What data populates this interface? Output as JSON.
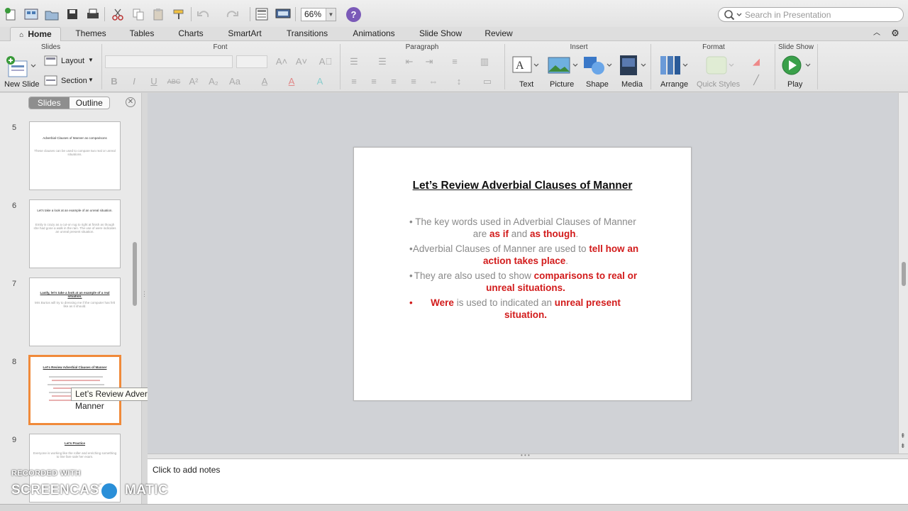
{
  "toolbar": {
    "zoom": "66%",
    "help": "?",
    "search_placeholder": "Search in Presentation",
    "icons": [
      "new-icon",
      "templates-icon",
      "open-icon",
      "save-icon",
      "print-icon",
      "cut-icon",
      "copy-icon",
      "paste-icon",
      "format-painter-icon",
      "undo-icon",
      "redo-icon",
      "slide-sorter-icon",
      "present-icon",
      "help-icon"
    ]
  },
  "tabs": [
    "Home",
    "Themes",
    "Tables",
    "Charts",
    "SmartArt",
    "Transitions",
    "Animations",
    "Slide Show",
    "Review"
  ],
  "ribbon": {
    "groups": {
      "slides": "Slides",
      "font": "Font",
      "paragraph": "Paragraph",
      "insert": "Insert",
      "format": "Format",
      "slideshow": "Slide Show"
    },
    "new_slide": "New Slide",
    "layout": "Layout",
    "section": "Section",
    "text": "Text",
    "picture": "Picture",
    "shape": "Shape",
    "media": "Media",
    "arrange": "Arrange",
    "quick_styles": "Quick Styles",
    "play": "Play"
  },
  "panel": {
    "seg_slides": "Slides",
    "seg_outline": "Outline",
    "slides": [
      {
        "num": "5",
        "title": "Adverbial Clauses of Manner as comparisons",
        "body": "These clauses can be used to compare two real or unreal situations."
      },
      {
        "num": "6",
        "title": "Let's take a look at an example of an unreal situation.",
        "body": "Emily is crazy as a cut-on rug to right at finish as though she had gone a walk in the rain. The use of were indicates an unreal present situation."
      },
      {
        "num": "7",
        "title": "Lastly, let's take a look at an example of a real situation.",
        "body": "Mrs Burtos will try to dressing me if the computer has felt like as it should."
      },
      {
        "num": "8",
        "title": "Let's Review Adverbial Clauses of Manner",
        "body": ""
      },
      {
        "num": "9",
        "title": "Let's Practice",
        "body": "Everyone is working like the roller and enriching something to line fare sale her exam."
      }
    ],
    "tooltip": "Let’s Review Adverbial Clauses of Manner"
  },
  "slide": {
    "title": "Let’s Review Adverbial Clauses of Manner",
    "b1_pre": "The key words used in Adverbial Clauses of Manner are ",
    "b1_r1": "as if",
    "b1_mid": " and ",
    "b1_r2": "as though",
    "b1_end": ".",
    "b2_pre": "Adverbial Clauses of Manner are used to ",
    "b2_r": "tell how an action takes place",
    "b2_end": ".",
    "b3_pre": "They are also used to show ",
    "b3_r": "comparisons to real  or unreal situations.",
    "b4_r1": "Were",
    "b4_mid": " is used to indicated an ",
    "b4_r2": "unreal present situation."
  },
  "notes_placeholder": "Click to add notes",
  "watermark": {
    "line1": "RECORDED WITH",
    "left": "SCREENCAST",
    "right": "MATIC"
  },
  "colors": {
    "accent_red": "#d21b1b",
    "selection": "#f08a3a",
    "help_purple": "#7b5ab8"
  }
}
